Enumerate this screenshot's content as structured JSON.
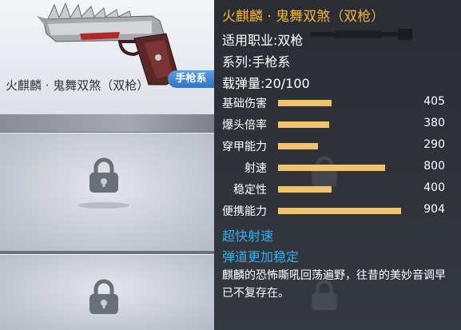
{
  "weapon": {
    "title": "火麒麟 · 鬼舞双煞（双枪）",
    "caption": "火麒麟 · 鬼舞双煞（双枪）",
    "class_tag": "手枪系"
  },
  "info": {
    "job": "适用职业:双枪",
    "series": "系列:手枪系",
    "ammo": "载弹量:20/100"
  },
  "stats": [
    {
      "label": "基础伤害",
      "value": "405",
      "fill": 0.42
    },
    {
      "label": "爆头倍率",
      "value": "380",
      "fill": 0.4
    },
    {
      "label": "穿甲能力",
      "value": "290",
      "fill": 0.31
    },
    {
      "label": "射速",
      "value": "800",
      "fill": 0.84
    },
    {
      "label": "稳定性",
      "value": "400",
      "fill": 0.42
    },
    {
      "label": "便携能力",
      "value": "904",
      "fill": 0.96
    }
  ],
  "features": [
    "超快射速",
    "弹道更加稳定"
  ],
  "description": "麒麟的恐怖嘶吼回荡遍野，往昔的美妙音调早已不复存在。",
  "icons": {
    "weapon": "dual-pistol-weapon-image",
    "lock": "lock-icon"
  },
  "colors": {
    "title": "#f5b335",
    "feature": "#2fb1f2",
    "bar": "#f0c36c",
    "tag": "#2f73c4"
  }
}
